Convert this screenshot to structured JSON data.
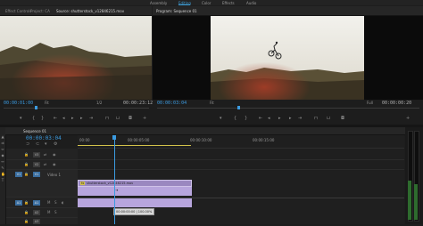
{
  "workspace": {
    "tabs": [
      "Assembly",
      "Editing",
      "Color",
      "Effects",
      "Audio"
    ],
    "active": "Editing"
  },
  "source_panel": {
    "tabs": [
      "Effect Controls",
      "Project: CA",
      "Source: shutterstock_v12846215.mov"
    ],
    "timecode_in": "00:00:01:00",
    "fit": "Fit",
    "resolution": "1/2",
    "timecode_duration": "00:00:23:12"
  },
  "program_panel": {
    "tab": "Program: Sequence 01",
    "timecode_in": "00:00:03:04",
    "fit": "Fit",
    "resolution": "Full",
    "timecode_duration": "00:00:00:20"
  },
  "timeline": {
    "tab": "Sequence 01",
    "timecode": "00:00:03:04",
    "ruler_labels": [
      "00:00",
      "00:00:05:00",
      "00:00:10:00",
      "00:00:15:00"
    ],
    "tracks": [
      {
        "id": "v3",
        "src": "",
        "name": "V3"
      },
      {
        "id": "v2",
        "src": "",
        "name": "V2"
      },
      {
        "id": "v1",
        "src": "V1",
        "name": "V1",
        "label": "Video 1"
      },
      {
        "id": "a1",
        "src": "A1",
        "name": "A1"
      },
      {
        "id": "a2",
        "src": "",
        "name": "A2"
      },
      {
        "id": "a3",
        "src": "",
        "name": "A3"
      }
    ],
    "clip_name": "shutterstock_v12846215.mov",
    "clip_marker": "fx",
    "tooltip": "00:00:00:00  |  100.00%"
  },
  "colors": {
    "accent": "#3b9be0",
    "clip_video": "#9a88c0",
    "clip_audio": "#b7a5dd",
    "yellow_bar": "#d3c24a"
  }
}
